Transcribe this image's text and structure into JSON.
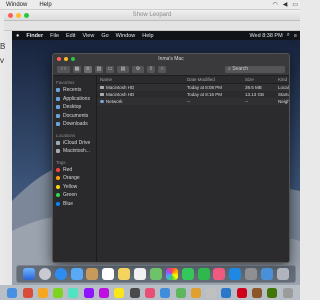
{
  "host_menubar": {
    "items": [
      "Window",
      "Help"
    ]
  },
  "host_window": {
    "title": "Show Leopard",
    "sidebar_fragments": [
      "B",
      "v"
    ]
  },
  "guest_menubar": {
    "app": "Finder",
    "items": [
      "File",
      "Edit",
      "View",
      "Go",
      "Window",
      "Help"
    ],
    "clock": "Wed 8:38 PM"
  },
  "finder": {
    "window_title": "Inma's Mac",
    "search_placeholder": "Search",
    "columns": {
      "name": "Name",
      "date": "Date Modified",
      "size": "Size",
      "kind": "Kind"
    },
    "rows": [
      {
        "name": "Macintosh HD",
        "date": "Today at 8:08 PM",
        "size": "39.5 MB",
        "kind": "Local Volume"
      },
      {
        "name": "Macintosh HD",
        "date": "Today at 8:16 PM",
        "size": "13.13 GB",
        "kind": "Startup Volume"
      },
      {
        "name": "Network",
        "date": "--",
        "size": "--",
        "kind": "Neighborhood"
      }
    ],
    "sidebar": {
      "favorites_label": "Favorites",
      "favorites": [
        "Recents",
        "Applications",
        "Desktop",
        "Documents",
        "Downloads"
      ],
      "locations_label": "Locations",
      "locations": [
        "iCloud Drive",
        "Macintosh..."
      ],
      "tags_label": "Tags",
      "tags": [
        {
          "label": "Red",
          "color": "#ff453a"
        },
        {
          "label": "Orange",
          "color": "#ff9f0a"
        },
        {
          "label": "Yellow",
          "color": "#ffd60a"
        },
        {
          "label": "Green",
          "color": "#32d74b"
        },
        {
          "label": "Blue",
          "color": "#0a84ff"
        }
      ]
    }
  },
  "colors": {
    "accent": "#0a84ff",
    "finder_bg": "#2b2b2d"
  }
}
